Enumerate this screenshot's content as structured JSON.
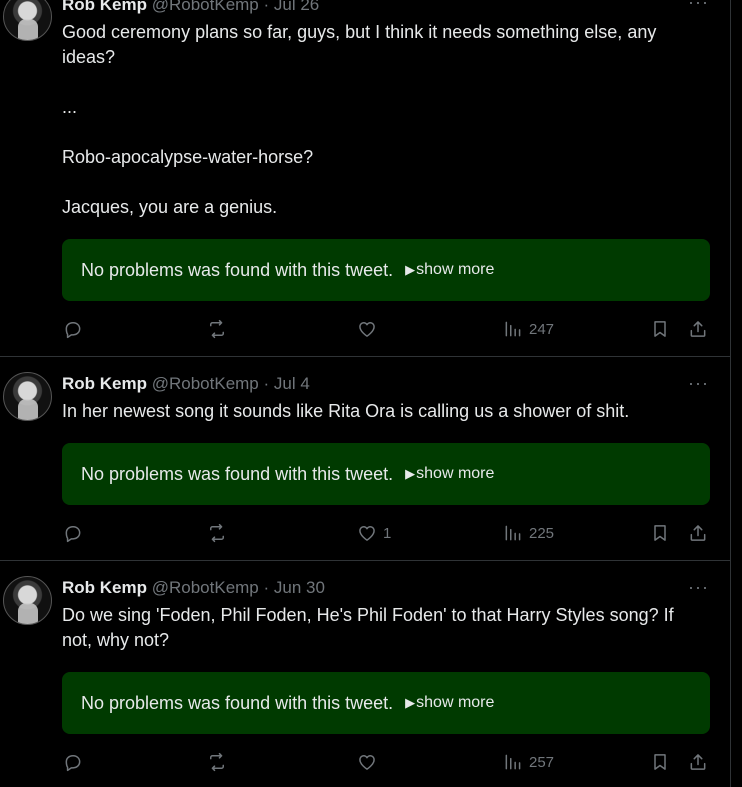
{
  "tweets": [
    {
      "author_name": "Rob Kemp",
      "handle_date": "@RobotKemp · Jul 26",
      "paragraphs": [
        "Good ceremony plans so far, guys, but I think it needs something else, any ideas?",
        "...",
        "Robo-apocalypse-water-horse?",
        "Jacques, you are a genius."
      ],
      "check_text": "No problems was found with this tweet.",
      "show_more": "show more",
      "like_count": "",
      "view_count": "247"
    },
    {
      "author_name": "Rob Kemp",
      "handle_date": "@RobotKemp · Jul 4",
      "paragraphs": [
        "In her newest song it sounds like Rita Ora is calling us a shower of shit."
      ],
      "check_text": "No problems was found with this tweet.",
      "show_more": "show more",
      "like_count": "1",
      "view_count": "225"
    },
    {
      "author_name": "Rob Kemp",
      "handle_date": "@RobotKemp · Jun 30",
      "paragraphs": [
        "Do we sing 'Foden, Phil Foden, He's  Phil Foden' to that Harry Styles song? If not, why not?"
      ],
      "check_text": "No problems was found with this tweet.",
      "show_more": "show more",
      "like_count": "",
      "view_count": "257"
    }
  ],
  "icons": {
    "reply": "reply-icon",
    "retweet": "retweet-icon",
    "like": "heart-icon",
    "views": "views-chart-icon",
    "bookmark": "bookmark-icon",
    "share": "share-icon",
    "more": "more-dots-icon"
  },
  "colors": {
    "background": "#000000",
    "text": "#e7e9ea",
    "muted": "#71767b",
    "check_box_bg": "#003a00",
    "divider": "#2f3336"
  }
}
